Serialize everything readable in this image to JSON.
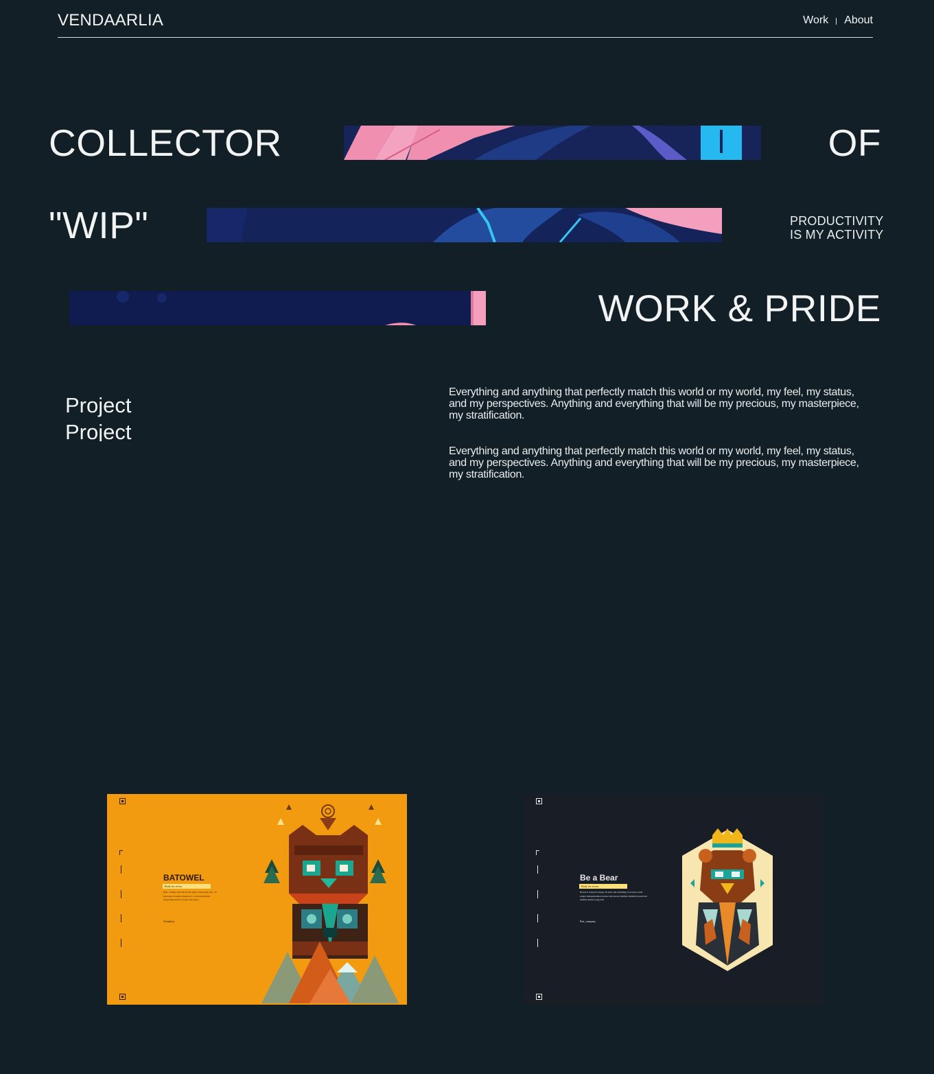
{
  "header": {
    "brand": "VENDAARLIA",
    "nav": [
      {
        "label": "Work"
      },
      {
        "label": "About"
      }
    ]
  },
  "hero": {
    "row1": {
      "left": "COLLECTOR",
      "right": "OF"
    },
    "row2": {
      "left": "\"WIP\"",
      "tagline_line1": "PRODUCTIVITY",
      "tagline_line2": "IS MY ACTIVITY"
    },
    "row3": {
      "right": "WORK & PRIDE"
    }
  },
  "intro": {
    "heading": "Project",
    "heading_next": "Project",
    "paragraphs": [
      "Everything and anything that perfectly match this world or my world, my feel, my status, and my perspectives. Anything and everything that will be my precious, my masterpiece, my stratification.",
      "Everything and anything that perfectly match this world or my world, my feel, my status, and my perspectives. Anything and everything that will be my precious, my masterpiece, my stratification."
    ]
  },
  "projects": [
    {
      "title": "BATOWEL",
      "tag": "Body tex vector",
      "body": "Bak... dinguer hal trik di dan gunia orang yang ada... ba keterasan di sudut pangan kot, a ada untuk kamu masyarakat kasus kot gatu dan segan",
      "foot": "Wunabeyt",
      "bg_color": "#f29a10",
      "ink_color": "#2a1a10"
    },
    {
      "title": "Be a Bear",
      "tag": "Body tex vector",
      "body": "Beruwat orang bat hanga dit akan nun terhadang cara kerja sosial sangat memperhatikan karena lain hewan melihat dinilahm untuk biru melihat dirimu yang lain.",
      "foot": "Part_company",
      "bg_color": "#191e26",
      "ink_color": "#e6e6e6"
    }
  ]
}
